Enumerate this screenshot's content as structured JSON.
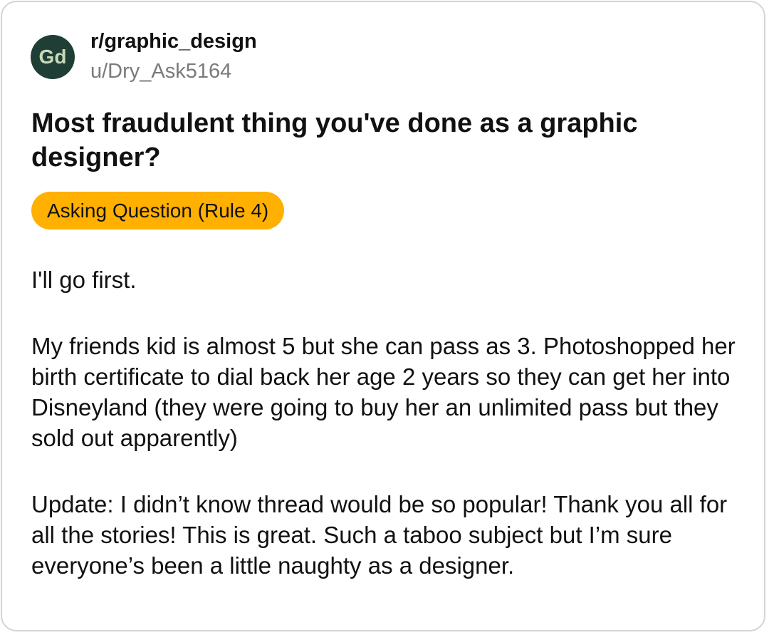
{
  "post": {
    "subreddit": "r/graphic_design",
    "avatar_text": "Gd",
    "avatar_color": "#1f3f36",
    "username": "u/Dry_Ask5164",
    "title": "Most fraudulent thing you've done as a graphic designer?",
    "flair": {
      "label": "Asking Question (Rule 4)",
      "color": "#ffb000"
    },
    "body": [
      "I'll go first.",
      "My friends kid is almost 5 but she can pass as 3. Photoshopped her birth certificate to dial back her age 2 years so they can get her into Disneyland (they were going to buy her an unlimited pass but they sold out apparently)",
      "Update: I didn’t know thread would be so popular! Thank you all for all the stories! This is great. Such a taboo subject but I’m sure everyone’s been a little naughty as a designer."
    ]
  }
}
